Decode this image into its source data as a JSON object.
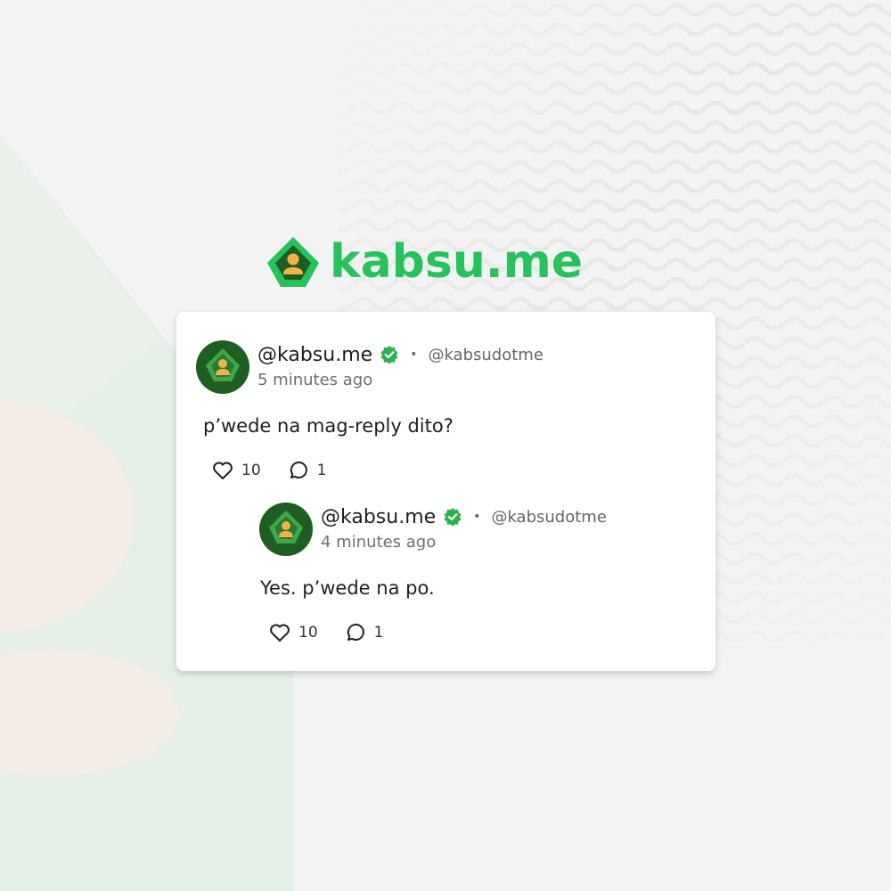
{
  "brand": {
    "name": "kabsu.me",
    "color": "#27c25c"
  },
  "post": {
    "handle": "@kabsu.me",
    "username": "@kabsudotme",
    "separator": "•",
    "time": "5 minutes ago",
    "content": "p’wede na mag-reply dito?",
    "likes": "10",
    "comments": "1",
    "icons": {
      "verified": "verified-badge-icon",
      "like": "heart-icon",
      "comment": "comment-icon"
    }
  },
  "reply": {
    "handle": "@kabsu.me",
    "username": "@kabsudotme",
    "separator": "•",
    "time": "4 minutes ago",
    "content": "Yes. p’wede na po.",
    "likes": "10",
    "comments": "1"
  },
  "colors": {
    "accent": "#27c25c",
    "avatar_bg": "#1e5e22",
    "avatar_diamond": "#3fa84a",
    "avatar_figure": "#f2b248",
    "verified": "#2cb24c"
  }
}
